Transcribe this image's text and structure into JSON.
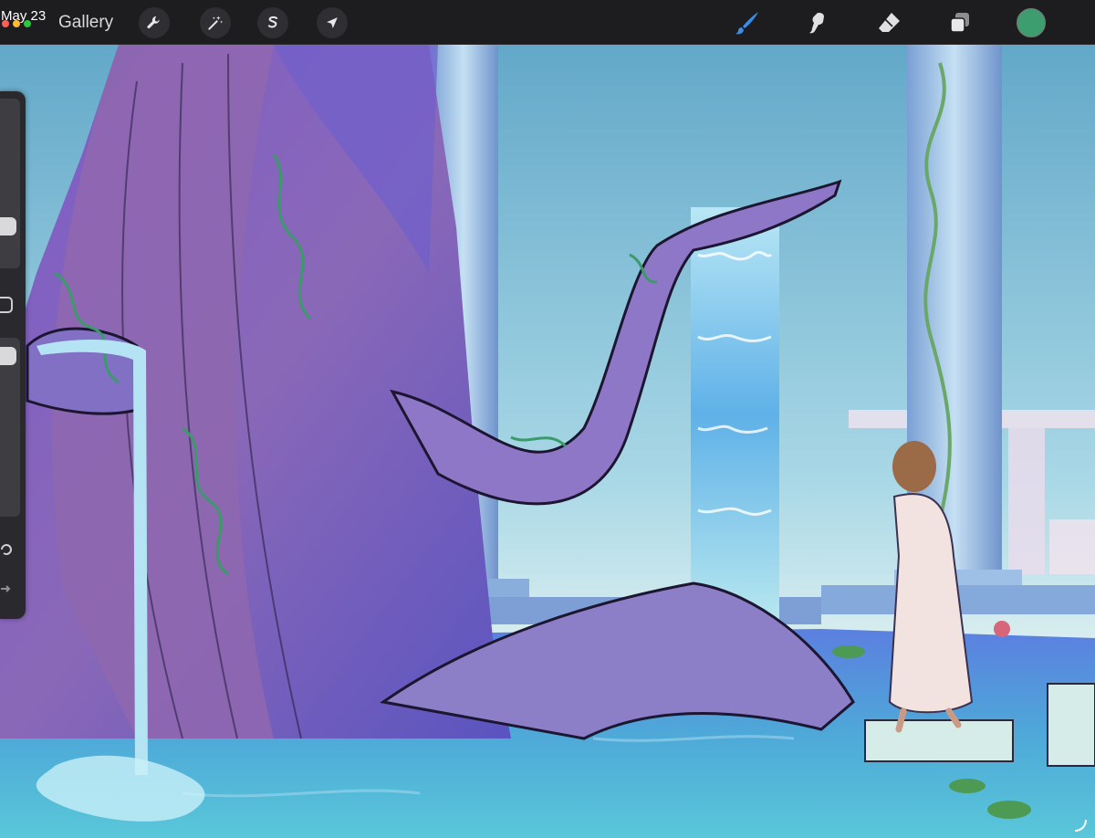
{
  "status": {
    "date": "May 23"
  },
  "toolbar": {
    "gallery_label": "Gallery",
    "left_tools": [
      "wrench-icon",
      "magic-wand-icon",
      "selection-s-icon",
      "move-arrow-icon"
    ],
    "right_tools": [
      "brush-icon",
      "smudge-icon",
      "eraser-icon",
      "layers-icon"
    ],
    "brush_active_color": "#3a8ee8",
    "current_color": "#3d9d6e"
  },
  "colors": {
    "traffic_red": "#ff5f57",
    "traffic_yellow": "#febc2e",
    "traffic_green": "#28c840"
  },
  "sidebar": {
    "brush_size": 0.25,
    "opacity": 0.05
  }
}
